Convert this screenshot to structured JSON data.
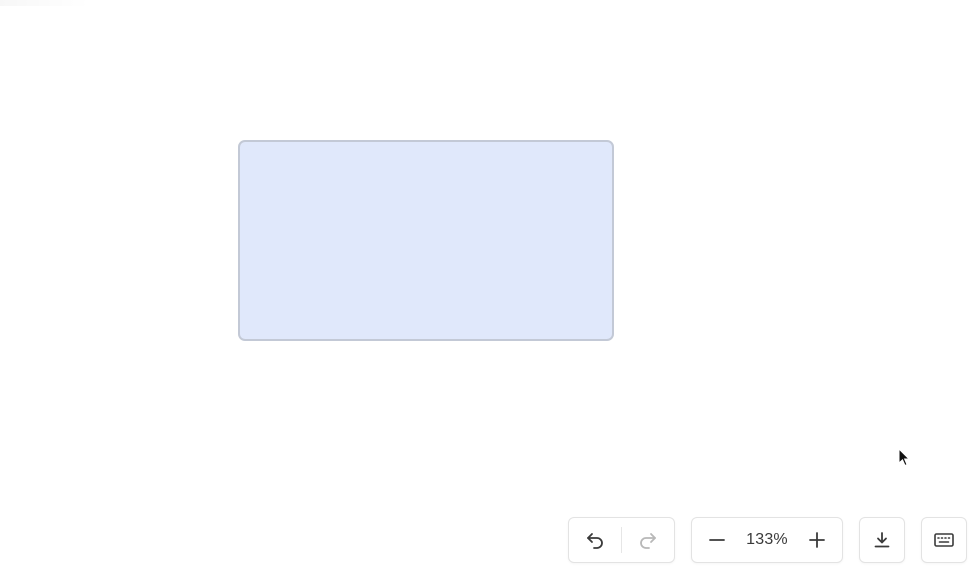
{
  "canvas": {
    "shape_fill": "#e0e8fb",
    "shape_stroke": "#c3c9d6"
  },
  "toolbar": {
    "history": {
      "undo_icon": "undo-icon",
      "redo_icon": "redo-icon",
      "redo_enabled": false
    },
    "zoom": {
      "zoom_out_icon": "minus-icon",
      "level": "133%",
      "zoom_in_icon": "plus-icon"
    },
    "download_icon": "download-icon",
    "keyboard_icon": "keyboard-icon"
  },
  "colors": {
    "icon": "#3a3a3a",
    "icon_disabled": "#b8b8b8",
    "toolbar_border": "#e3e3e3"
  }
}
